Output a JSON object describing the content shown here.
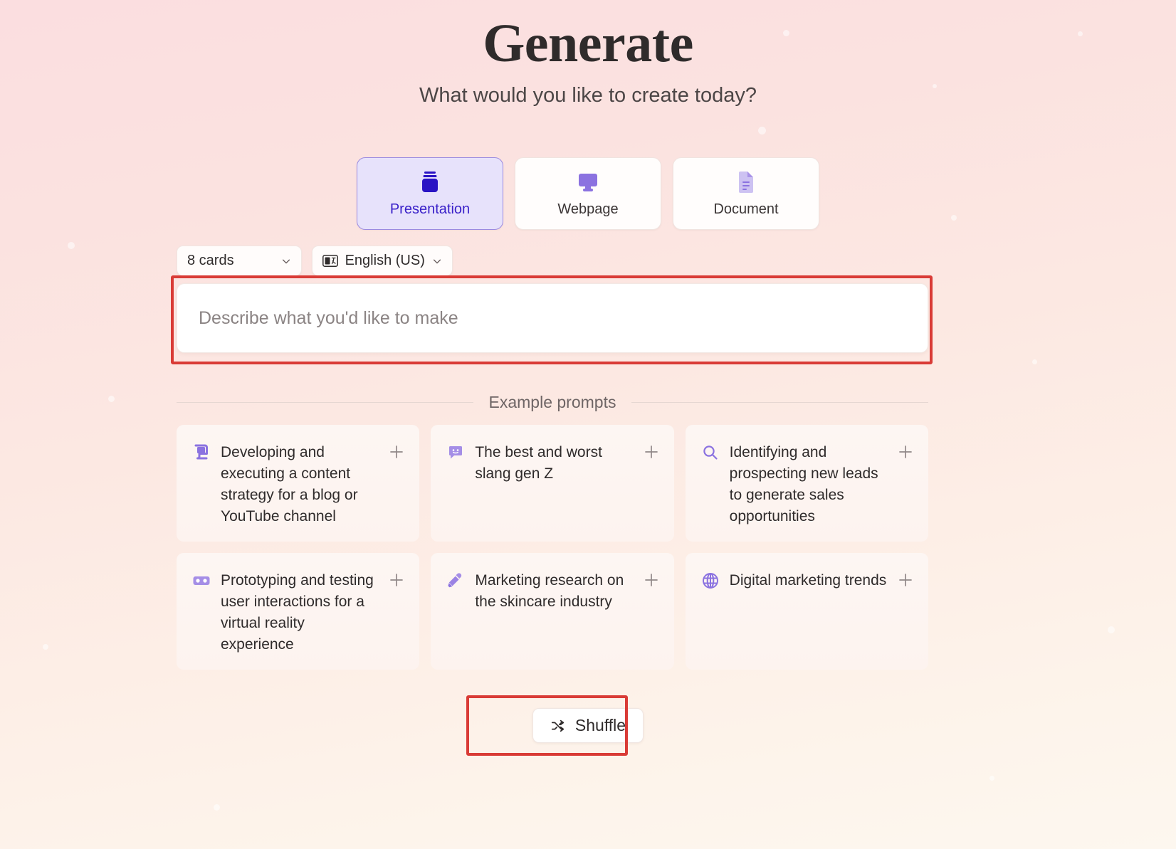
{
  "header": {
    "title": "Generate",
    "subtitle": "What would you like to create today?"
  },
  "type_selector": {
    "options": [
      {
        "label": "Presentation",
        "icon": "slides-stack-icon",
        "selected": true
      },
      {
        "label": "Webpage",
        "icon": "monitor-icon",
        "selected": false
      },
      {
        "label": "Document",
        "icon": "document-icon",
        "selected": false
      }
    ]
  },
  "options_bar": {
    "card_count": {
      "value": "8 cards",
      "icon": "chevron-down-icon"
    },
    "language": {
      "value": "English (US)",
      "icon": "language-icon",
      "chevron": "chevron-down-icon"
    }
  },
  "prompt": {
    "placeholder": "Describe what you'd like to make",
    "value": ""
  },
  "examples": {
    "divider_label": "Example prompts",
    "cards": [
      {
        "text": "Developing and executing a content strategy for a blog or YouTube channel",
        "icon": "scroll-icon",
        "add": "plus-icon"
      },
      {
        "text": "The best and worst slang gen Z",
        "icon": "smiley-chat-icon",
        "add": "plus-icon"
      },
      {
        "text": "Identifying and prospecting new leads to generate sales opportunities",
        "icon": "search-icon",
        "add": "plus-icon"
      },
      {
        "text": "Prototyping and testing user interactions for a virtual reality experience",
        "icon": "vr-headset-icon",
        "add": "plus-icon"
      },
      {
        "text": "Marketing research on the skincare industry",
        "icon": "eyedropper-icon",
        "add": "plus-icon"
      },
      {
        "text": "Digital marketing trends",
        "icon": "globe-icon",
        "add": "plus-icon"
      }
    ]
  },
  "shuffle": {
    "label": "Shuffle",
    "icon": "shuffle-icon"
  },
  "colors": {
    "accent_purple": "#3a21c9",
    "icon_purple": "#8b72e0",
    "selected_card_bg": "#e7e2fb",
    "annotation_red": "#d93b36",
    "text_dark": "#2f2b2b"
  }
}
